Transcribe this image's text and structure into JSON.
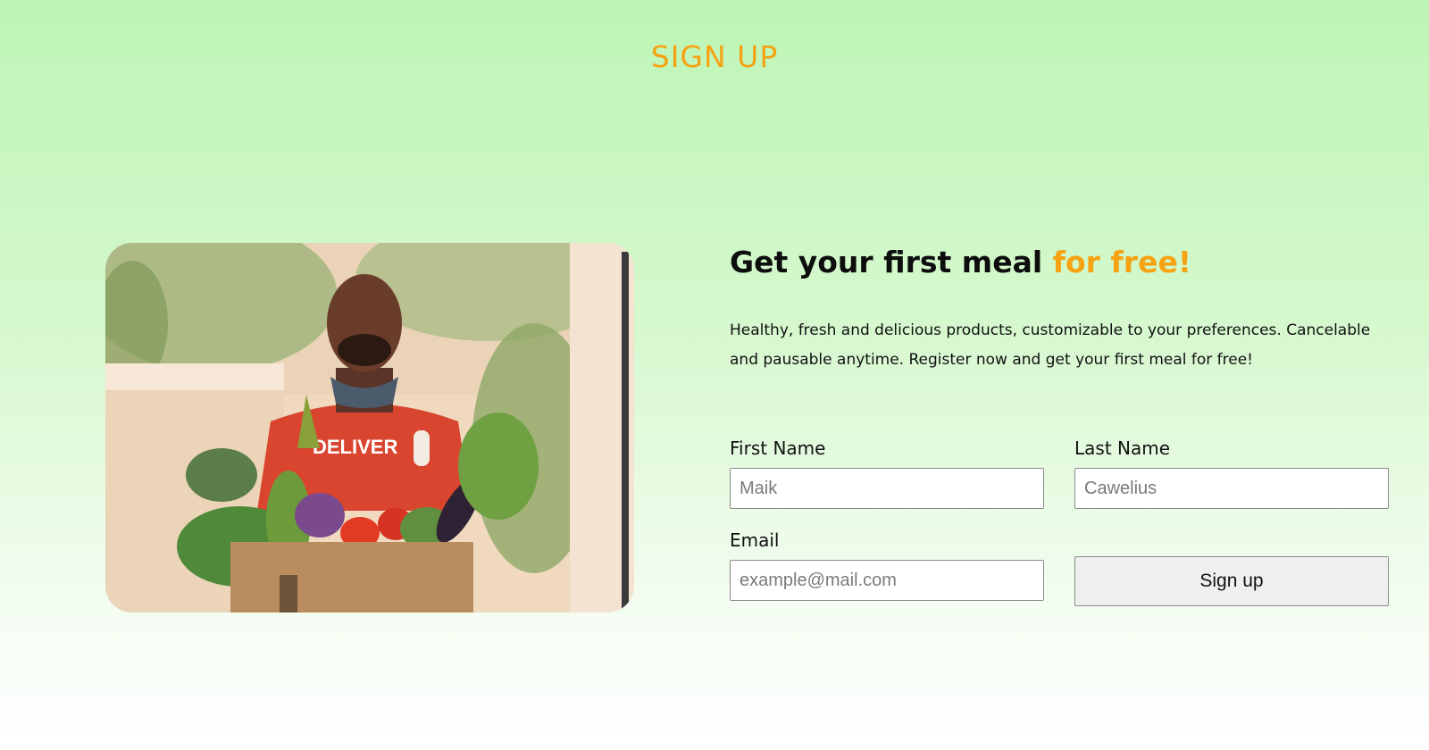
{
  "section": {
    "title": "SIGN UP"
  },
  "hero": {
    "image_alt": "Delivery person holding a box of fresh vegetables",
    "shirt_text": "DELIVER"
  },
  "headline": {
    "text": "Get your first meal ",
    "accent": "for free!"
  },
  "description": "Healthy, fresh and delicious products, customizable to your preferences. Cancelable and pausable anytime. Register now and get your first meal for free!",
  "form": {
    "first_name": {
      "label": "First Name",
      "placeholder": "Maik"
    },
    "last_name": {
      "label": "Last Name",
      "placeholder": "Cawelius"
    },
    "email": {
      "label": "Email",
      "placeholder": "example@mail.com"
    },
    "submit_label": "Sign up"
  },
  "colors": {
    "accent": "#f5a312",
    "background_top": "#bdf5b5",
    "background_bottom": "#ffffff"
  }
}
